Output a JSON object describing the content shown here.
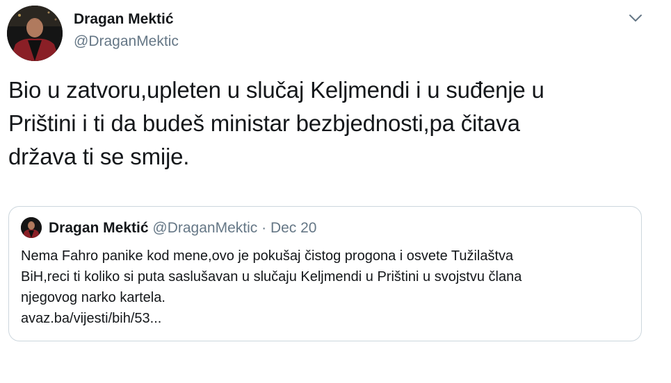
{
  "author": {
    "name": "Dragan Mektić",
    "handle": "@DraganMektic"
  },
  "menu": {
    "icon": "chevron-down-icon"
  },
  "tweet": {
    "lines": [
      "Bio u zatvoru,upleten u slučaj Keljmendi i u suđenje u",
      "Prištini i ti da budeš ministar bezbjednosti,pa čitava",
      "država ti se smije."
    ]
  },
  "quoted_tweet": {
    "name": "Dragan Mektić",
    "handle": "@DraganMektic",
    "separator": "·",
    "date": "Dec 20",
    "lines": [
      "Nema Fahro panike kod mene,ovo je pokušaj čistog progona i osvete Tužilaštva",
      "BiH,reci ti koliko si puta saslušavan u slučaju Keljmendi u Prištini u svojstvu člana",
      "njegovog narko kartela.",
      "avaz.ba/vijesti/bih/53..."
    ]
  },
  "colors": {
    "text": "#14171a",
    "secondary": "#657786",
    "border": "#ccd6dd"
  }
}
